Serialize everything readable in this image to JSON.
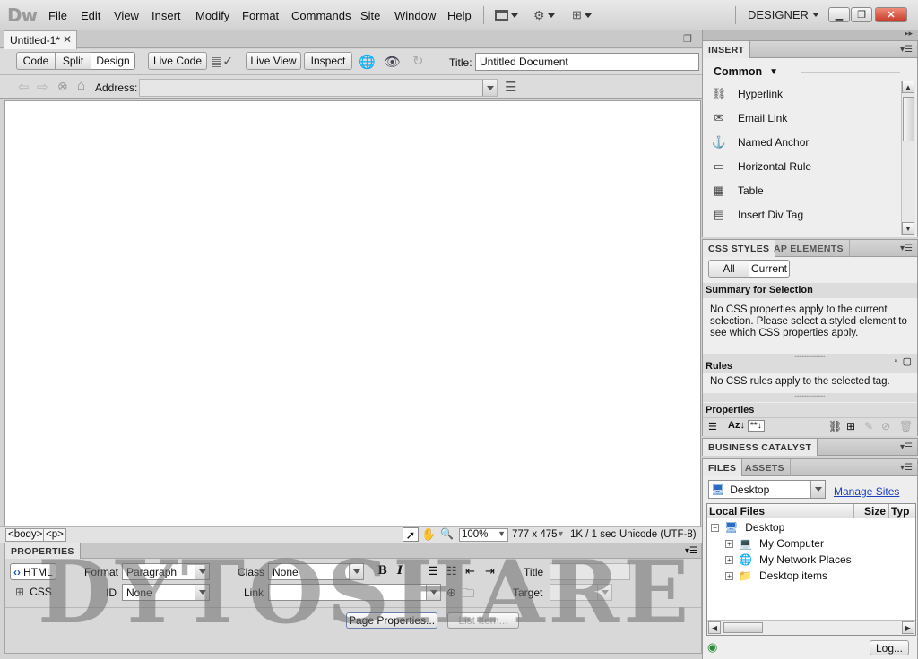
{
  "app": {
    "logo": "Dw",
    "workspace": "DESIGNER"
  },
  "menu": [
    "File",
    "Edit",
    "View",
    "Insert",
    "Modify",
    "Format",
    "Commands",
    "Site",
    "Window",
    "Help"
  ],
  "document": {
    "tab": "Untitled-1*",
    "title_label": "Title:",
    "title_value": "Untitled Document"
  },
  "toolbar": {
    "code": "Code",
    "split": "Split",
    "design": "Design",
    "live_code": "Live Code",
    "live_view": "Live View",
    "inspect": "Inspect"
  },
  "address": {
    "label": "Address:",
    "value": ""
  },
  "status": {
    "tags": [
      "<body>",
      "<p>"
    ],
    "zoom": "100%",
    "dimensions": "777 x 475",
    "size": "1K / 1 sec",
    "encoding": "Unicode (UTF-8)"
  },
  "properties": {
    "header": "PROPERTIES",
    "html": "HTML",
    "css": "CSS",
    "format_label": "Format",
    "format_value": "Paragraph",
    "id_label": "ID",
    "id_value": "None",
    "class_label": "Class",
    "class_value": "None",
    "link_label": "Link",
    "link_value": "",
    "bold": "B",
    "italic": "I",
    "title_label": "Title",
    "target_label": "Target",
    "page_properties": "Page Properties...",
    "list_item": "List Item..."
  },
  "insert_panel": {
    "header": "INSERT",
    "category": "Common",
    "items": [
      {
        "label": "Hyperlink",
        "icon": "hyperlink-icon"
      },
      {
        "label": "Email Link",
        "icon": "email-icon"
      },
      {
        "label": "Named Anchor",
        "icon": "anchor-icon"
      },
      {
        "label": "Horizontal Rule",
        "icon": "rule-icon"
      },
      {
        "label": "Table",
        "icon": "table-icon"
      },
      {
        "label": "Insert Div Tag",
        "icon": "div-icon"
      }
    ]
  },
  "css_panel": {
    "tabs": [
      "CSS STYLES",
      "AP ELEMENTS"
    ],
    "all": "All",
    "current": "Current",
    "summary_title": "Summary for Selection",
    "summary_text": "No CSS properties apply to the current selection.  Please select a styled element to see which CSS properties apply.",
    "rules_title": "Rules",
    "rules_text": "No CSS rules apply to the selected tag.",
    "properties_title": "Properties"
  },
  "business_catalyst": {
    "header": "BUSINESS CATALYST"
  },
  "files_panel": {
    "tabs": [
      "FILES",
      "ASSETS"
    ],
    "site": "Desktop",
    "manage_sites": "Manage Sites",
    "col_local": "Local Files",
    "col_size": "Size",
    "col_type": "Typ",
    "tree": [
      {
        "label": "Desktop",
        "level": 0,
        "icon": "desktop-icon"
      },
      {
        "label": "My Computer",
        "level": 1,
        "icon": "computer-icon"
      },
      {
        "label": "My Network Places",
        "level": 1,
        "icon": "network-icon"
      },
      {
        "label": "Desktop items",
        "level": 1,
        "icon": "folder-icon"
      }
    ],
    "log": "Log..."
  },
  "watermark": "DYTOSHARE"
}
